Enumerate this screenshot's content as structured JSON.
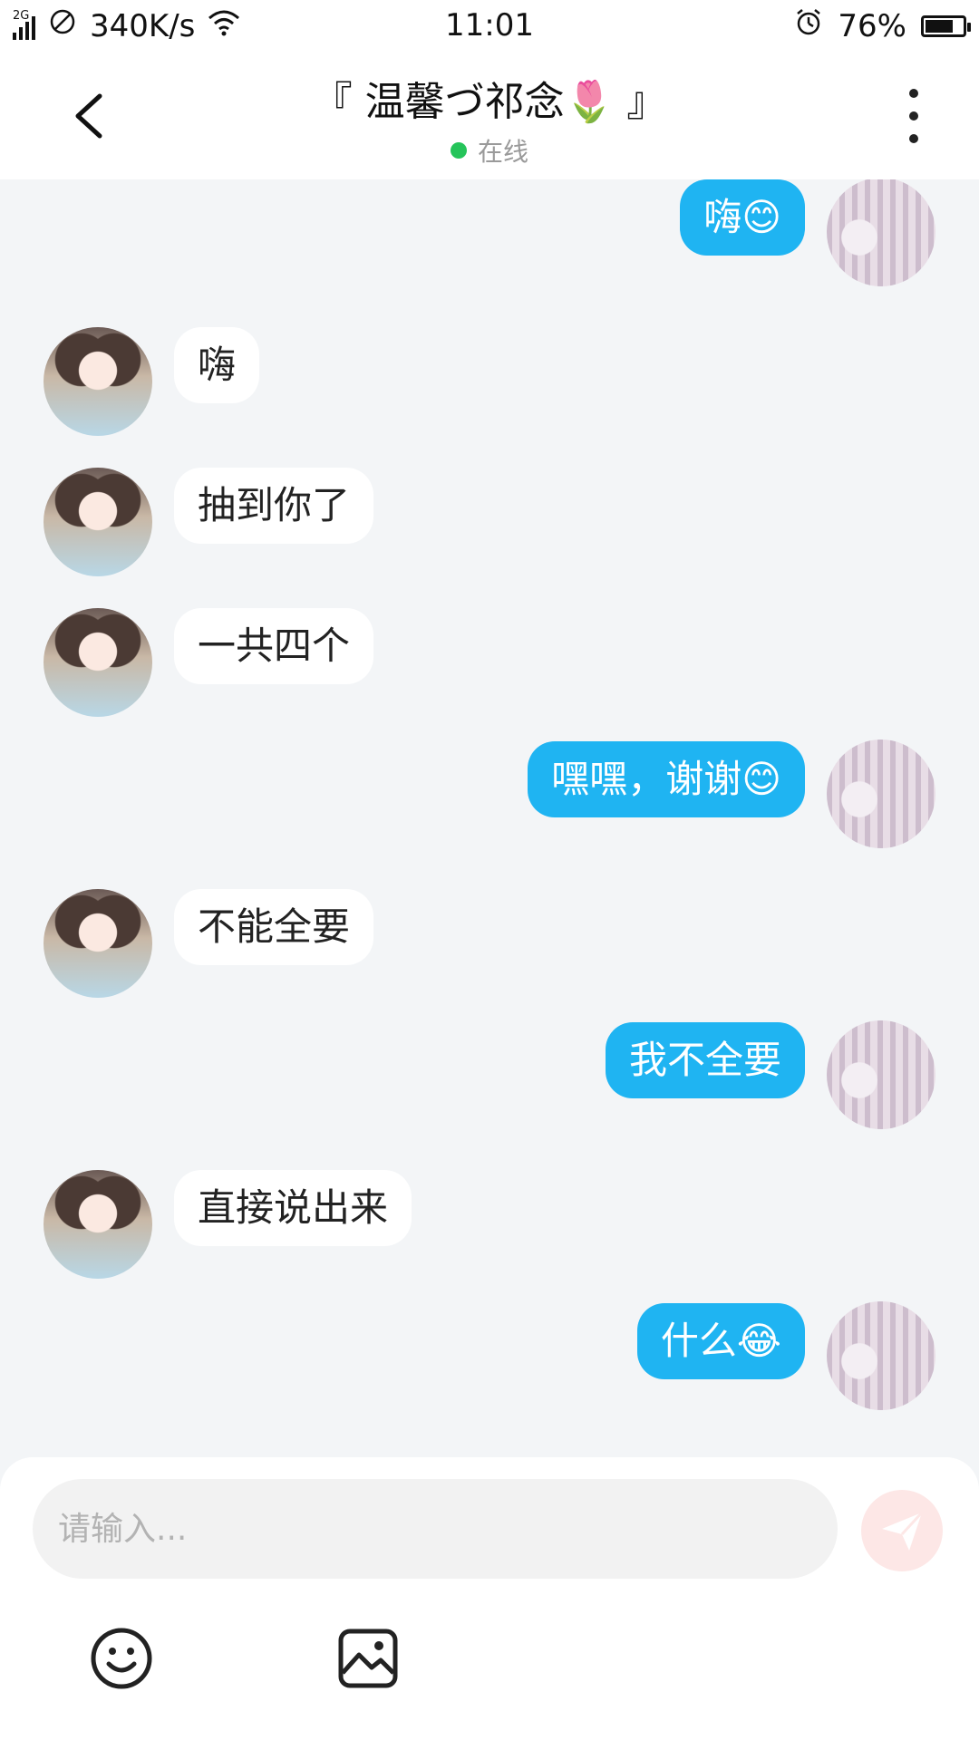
{
  "status_bar": {
    "network": "2G",
    "speed": "340K/s",
    "time": "11:01",
    "battery": "76%",
    "battery_level": 0.76
  },
  "header": {
    "title": "『 温馨づ祁念🌷 』",
    "status": "在线",
    "status_color": "#25c45a"
  },
  "messages": [
    {
      "side": "right",
      "text": "嗨😊"
    },
    {
      "side": "left",
      "text": "嗨"
    },
    {
      "side": "left",
      "text": "抽到你了"
    },
    {
      "side": "left",
      "text": "一共四个"
    },
    {
      "side": "right",
      "text": "嘿嘿，谢谢😊"
    },
    {
      "side": "left",
      "text": "不能全要"
    },
    {
      "side": "right",
      "text": "我不全要"
    },
    {
      "side": "left",
      "text": "直接说出来"
    },
    {
      "side": "right",
      "text": "什么😂"
    }
  ],
  "input": {
    "placeholder": "请输入..."
  },
  "icons": {
    "back": "chevron-left-icon",
    "more": "more-vertical-icon",
    "send": "send-icon",
    "emoji": "emoji-icon",
    "image": "image-icon"
  },
  "colors": {
    "bubble_self": "#1fb4f2",
    "bubble_other": "#ffffff",
    "chat_bg": "#f3f5f7",
    "send_button": "#fde7e6"
  }
}
